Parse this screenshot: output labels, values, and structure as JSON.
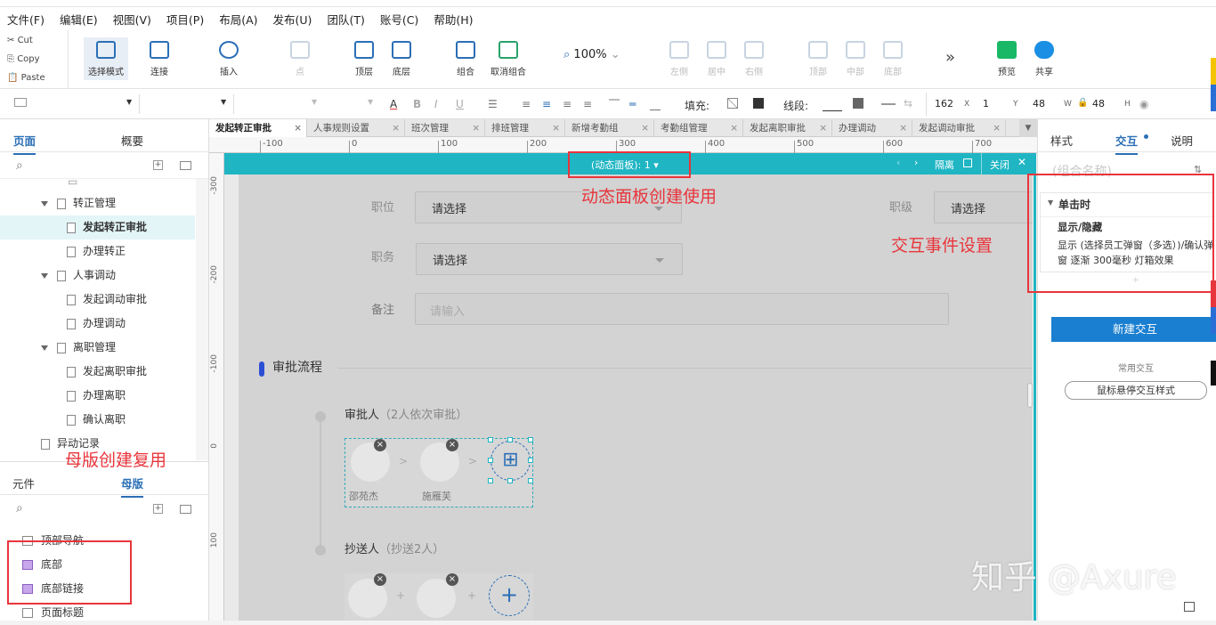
{
  "menu": [
    "文件(F)",
    "编辑(E)",
    "视图(V)",
    "项目(P)",
    "布局(A)",
    "发布(U)",
    "团队(T)",
    "账号(C)",
    "帮助(H)"
  ],
  "clipboard": {
    "cut": "Cut",
    "copy": "Copy",
    "paste": "Paste"
  },
  "toolbar": {
    "select_mode": "选择模式",
    "connect": "连接",
    "insert": "插入",
    "point": "点",
    "top_layer": "顶层",
    "bottom_layer": "底层",
    "group": "组合",
    "ungroup": "取消组合",
    "zoom": "100%",
    "align_left": "左侧",
    "align_center": "居中",
    "align_right": "右侧",
    "align_top": "顶部",
    "align_middle": "中部",
    "align_bottom": "底部",
    "more": "»",
    "preview": "预览",
    "share": "共享"
  },
  "format": {
    "fill_label": "填充:",
    "stroke_label": "线段:",
    "x": "162",
    "x_label": "X",
    "y": "1",
    "y_label": "Y",
    "w": "48",
    "w_label": "W",
    "h": "48",
    "h_label": "H"
  },
  "left_panel": {
    "tab_pages": "页面",
    "tab_outline": "概要",
    "tree": [
      {
        "label": "转正管理",
        "type": "folder",
        "indent": 1
      },
      {
        "label": "发起转正审批",
        "type": "page",
        "indent": 2,
        "selected": true
      },
      {
        "label": "办理转正",
        "type": "page",
        "indent": 2
      },
      {
        "label": "人事调动",
        "type": "folder",
        "indent": 1
      },
      {
        "label": "发起调动审批",
        "type": "page",
        "indent": 2
      },
      {
        "label": "办理调动",
        "type": "page",
        "indent": 2
      },
      {
        "label": "离职管理",
        "type": "folder",
        "indent": 1
      },
      {
        "label": "发起离职审批",
        "type": "page",
        "indent": 2
      },
      {
        "label": "办理离职",
        "type": "page",
        "indent": 2
      },
      {
        "label": "确认离职",
        "type": "page",
        "indent": 2
      },
      {
        "label": "异动记录",
        "type": "page",
        "indent": 1
      }
    ],
    "tab_widgets": "元件",
    "tab_masters": "母版",
    "masters": [
      "顶部导航",
      "底部",
      "底部链接",
      "页面标题"
    ]
  },
  "doc_tabs": [
    "发起转正审批",
    "人事规则设置",
    "班次管理",
    "排班管理",
    "新增考勤组",
    "考勤组管理",
    "发起离职审批",
    "办理调动",
    "发起调动审批"
  ],
  "ruler_h": [
    "-100",
    "0",
    "100",
    "200",
    "300",
    "400",
    "500",
    "600",
    "700"
  ],
  "ruler_v": [
    "-300",
    "-200",
    "-100",
    "0",
    "100"
  ],
  "canvas": {
    "panel_state": "(动态面板): 1 ▾",
    "isolate": "隔离",
    "close": "关闭",
    "form": {
      "position_label": "职位",
      "position_value": "请选择",
      "level_label": "职级",
      "level_value": "请选择",
      "duty_label": "职务",
      "duty_value": "请选择",
      "remark_label": "备注",
      "remark_placeholder": "请输入"
    },
    "approval_title": "审批流程",
    "approver_label": "审批人",
    "approver_note": "（2人依次审批）",
    "approvers": [
      "邵苑杰",
      "施雁芙"
    ],
    "cc_label": "抄送人",
    "cc_note": "（抄送2人）"
  },
  "right_panel": {
    "tab_style": "样式",
    "tab_interact": "交互",
    "tab_notes": "说明",
    "group_name_placeholder": "(组合名称)",
    "event": "单击时",
    "action_title": "显示/隐藏",
    "action_detail": "显示 (选择员工弹窗（多选）)/确认弹窗 逐渐 300毫秒 灯箱效果",
    "new_interaction": "新建交互",
    "common_label": "常用交互",
    "hover_style": "鼠标悬停交互样式"
  },
  "annotations": {
    "dynamic_panel": "动态面板创建使用",
    "interaction": "交互事件设置",
    "master": "母版创建复用"
  },
  "watermark": "知乎 @Axure"
}
